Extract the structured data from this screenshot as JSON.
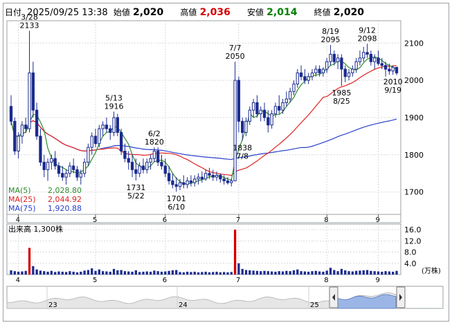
{
  "header": {
    "date_label": "日付",
    "datetime": "2025/09/25 13:38",
    "open_label": "始値",
    "open": "2,020",
    "high_label": "高値",
    "high": "2,036",
    "low_label": "安値",
    "low": "2,014",
    "close_label": "終値",
    "close": "2,020"
  },
  "colors": {
    "ma5": "#2e8b2e",
    "ma25": "#e02020",
    "ma75": "#2a3fc9",
    "candle_up": "#ffffff",
    "candle_down": "#1b2b8f",
    "high_value": "#d40000",
    "low_value": "#008000",
    "volume_bar": "#1b2b8f",
    "volume_spike": "#d40000",
    "nav_area": "#9bb6e6"
  },
  "chart_data": [
    {
      "type": "candlestick",
      "ylim": [
        1640,
        2160
      ],
      "yticks": [
        "2100",
        "2000",
        "1900",
        "1800",
        "1700"
      ],
      "months": [
        "4",
        "5",
        "6",
        "7",
        "8",
        "9"
      ],
      "legend": [
        {
          "name": "MA(5)",
          "value": "2,028.80"
        },
        {
          "name": "MA(25)",
          "value": "2,044.92"
        },
        {
          "name": "MA(75)",
          "value": "1,920.88"
        }
      ],
      "annotations": [
        {
          "date": "3/28",
          "value": "2133"
        },
        {
          "date": "5/13",
          "value": "1916"
        },
        {
          "date": "6/2",
          "value": "1820"
        },
        {
          "date": "5/22",
          "value": "1731"
        },
        {
          "date": "6/10",
          "value": "1701"
        },
        {
          "date": "7/7",
          "value": "2050"
        },
        {
          "date": "7/8",
          "value": "1838"
        },
        {
          "date": "8/19",
          "value": "2095"
        },
        {
          "date": "8/25",
          "value": "1985"
        },
        {
          "date": "9/12",
          "value": "2098"
        },
        {
          "date": "9/19",
          "value": "2010"
        }
      ],
      "ohlc": [
        [
          1930,
          1960,
          1880,
          1890
        ],
        [
          1890,
          1900,
          1800,
          1810
        ],
        [
          1810,
          1860,
          1790,
          1850
        ],
        [
          1850,
          1890,
          1830,
          1880
        ],
        [
          1880,
          1900,
          1860,
          1870
        ],
        [
          1870,
          2133,
          1860,
          2020
        ],
        [
          2020,
          2050,
          1900,
          1920
        ],
        [
          1920,
          1940,
          1840,
          1850
        ],
        [
          1850,
          1870,
          1770,
          1780
        ],
        [
          1780,
          1800,
          1740,
          1760
        ],
        [
          1760,
          1790,
          1730,
          1780
        ],
        [
          1780,
          1800,
          1760,
          1790
        ],
        [
          1790,
          1810,
          1760,
          1770
        ],
        [
          1770,
          1780,
          1740,
          1750
        ],
        [
          1750,
          1770,
          1730,
          1740
        ],
        [
          1740,
          1760,
          1720,
          1750
        ],
        [
          1750,
          1780,
          1740,
          1770
        ],
        [
          1770,
          1790,
          1750,
          1760
        ],
        [
          1760,
          1770,
          1730,
          1740
        ],
        [
          1740,
          1760,
          1720,
          1750
        ],
        [
          1750,
          1790,
          1740,
          1780
        ],
        [
          1780,
          1830,
          1770,
          1820
        ],
        [
          1820,
          1860,
          1800,
          1850
        ],
        [
          1850,
          1870,
          1820,
          1830
        ],
        [
          1830,
          1880,
          1820,
          1870
        ],
        [
          1870,
          1890,
          1850,
          1880
        ],
        [
          1880,
          1900,
          1860,
          1870
        ],
        [
          1870,
          1880,
          1840,
          1860
        ],
        [
          1860,
          1916,
          1850,
          1900
        ],
        [
          1900,
          1910,
          1850,
          1860
        ],
        [
          1860,
          1870,
          1800,
          1810
        ],
        [
          1810,
          1830,
          1780,
          1790
        ],
        [
          1790,
          1810,
          1760,
          1780
        ],
        [
          1780,
          1800,
          1740,
          1760
        ],
        [
          1760,
          1790,
          1731,
          1750
        ],
        [
          1750,
          1780,
          1740,
          1770
        ],
        [
          1770,
          1790,
          1750,
          1760
        ],
        [
          1760,
          1790,
          1750,
          1780
        ],
        [
          1780,
          1800,
          1760,
          1790
        ],
        [
          1790,
          1820,
          1780,
          1810
        ],
        [
          1810,
          1820,
          1770,
          1780
        ],
        [
          1780,
          1800,
          1760,
          1770
        ],
        [
          1770,
          1790,
          1740,
          1750
        ],
        [
          1750,
          1770,
          1720,
          1730
        ],
        [
          1730,
          1750,
          1710,
          1720
        ],
        [
          1720,
          1740,
          1701,
          1715
        ],
        [
          1715,
          1735,
          1705,
          1725
        ],
        [
          1725,
          1745,
          1710,
          1720
        ],
        [
          1720,
          1740,
          1710,
          1730
        ],
        [
          1730,
          1745,
          1715,
          1725
        ],
        [
          1725,
          1745,
          1715,
          1735
        ],
        [
          1735,
          1750,
          1720,
          1740
        ],
        [
          1740,
          1755,
          1725,
          1735
        ],
        [
          1735,
          1760,
          1730,
          1750
        ],
        [
          1750,
          1765,
          1735,
          1745
        ],
        [
          1745,
          1760,
          1730,
          1740
        ],
        [
          1740,
          1755,
          1730,
          1745
        ],
        [
          1745,
          1750,
          1725,
          1735
        ],
        [
          1735,
          1745,
          1720,
          1730
        ],
        [
          1730,
          1740,
          1720,
          1725
        ],
        [
          1725,
          1735,
          1715,
          1730
        ],
        [
          1730,
          2050,
          1838,
          2000
        ],
        [
          2000,
          2010,
          1860,
          1890
        ],
        [
          1890,
          1900,
          1838,
          1860
        ],
        [
          1860,
          1900,
          1850,
          1890
        ],
        [
          1890,
          1930,
          1880,
          1920
        ],
        [
          1920,
          1950,
          1900,
          1940
        ],
        [
          1940,
          1960,
          1900,
          1910
        ],
        [
          1910,
          1930,
          1890,
          1920
        ],
        [
          1920,
          1940,
          1890,
          1900
        ],
        [
          1900,
          1920,
          1860,
          1880
        ],
        [
          1880,
          1920,
          1870,
          1910
        ],
        [
          1910,
          1940,
          1900,
          1930
        ],
        [
          1930,
          1960,
          1910,
          1920
        ],
        [
          1920,
          1950,
          1910,
          1940
        ],
        [
          1940,
          1970,
          1930,
          1950
        ],
        [
          1950,
          1980,
          1940,
          1970
        ],
        [
          1970,
          2000,
          1960,
          1990
        ],
        [
          1990,
          2030,
          1980,
          2020
        ],
        [
          2020,
          2040,
          2000,
          2010
        ],
        [
          2010,
          2030,
          1990,
          2000
        ],
        [
          2000,
          2020,
          1990,
          2010
        ],
        [
          2010,
          2030,
          2000,
          2020
        ],
        [
          2020,
          2040,
          2010,
          2030
        ],
        [
          2030,
          2040,
          2010,
          2020
        ],
        [
          2020,
          2035,
          2010,
          2030
        ],
        [
          2030,
          2060,
          2020,
          2050
        ],
        [
          2050,
          2095,
          2040,
          2070
        ],
        [
          2070,
          2080,
          2040,
          2050
        ],
        [
          2050,
          2070,
          2030,
          2060
        ],
        [
          2060,
          2070,
          1985,
          2030
        ],
        [
          2030,
          2040,
          1995,
          2010
        ],
        [
          2010,
          2030,
          2000,
          2020
        ],
        [
          2020,
          2040,
          2010,
          2030
        ],
        [
          2030,
          2060,
          2020,
          2050
        ],
        [
          2050,
          2080,
          2040,
          2060
        ],
        [
          2060,
          2090,
          2050,
          2075
        ],
        [
          2075,
          2098,
          2060,
          2070
        ],
        [
          2070,
          2080,
          2040,
          2050
        ],
        [
          2050,
          2070,
          2030,
          2060
        ],
        [
          2060,
          2080,
          2040,
          2045
        ],
        [
          2045,
          2060,
          2030,
          2040
        ],
        [
          2040,
          2050,
          2010,
          2030
        ],
        [
          2030,
          2045,
          2015,
          2025
        ],
        [
          2025,
          2040,
          2015,
          2035
        ],
        [
          2035,
          2036,
          2014,
          2020
        ]
      ]
    },
    {
      "type": "bar",
      "title": "出来高",
      "value": "1,300株",
      "unit": "(万株)",
      "ylim": [
        0,
        18
      ],
      "yticks": [
        "16.0",
        "12.0",
        "8.0",
        "4.0"
      ],
      "months": [
        "4",
        "5",
        "6",
        "7",
        "8",
        "9"
      ],
      "values": [
        1.5,
        1.2,
        1.0,
        1.1,
        1.3,
        9.5,
        3.0,
        1.8,
        1.4,
        1.2,
        1.0,
        1.3,
        0.9,
        1.1,
        1.0,
        0.9,
        1.2,
        1.0,
        0.8,
        1.0,
        1.4,
        1.6,
        2.2,
        1.3,
        1.8,
        1.2,
        1.1,
        1.0,
        2.0,
        1.5,
        1.6,
        1.2,
        1.1,
        1.0,
        1.5,
        0.9,
        1.0,
        1.1,
        1.0,
        1.4,
        1.2,
        1.0,
        1.1,
        1.3,
        1.5,
        1.6,
        0.9,
        0.8,
        1.0,
        0.9,
        1.0,
        0.8,
        0.9,
        1.0,
        0.8,
        0.9,
        1.0,
        0.8,
        0.9,
        0.8,
        0.9,
        16.0,
        4.0,
        2.0,
        1.6,
        1.5,
        1.4,
        1.3,
        1.2,
        1.3,
        1.2,
        1.1,
        1.0,
        1.2,
        1.1,
        1.3,
        1.2,
        1.5,
        1.8,
        1.2,
        1.1,
        1.0,
        1.2,
        1.3,
        1.1,
        1.0,
        1.4,
        2.4,
        1.6,
        1.2,
        2.0,
        1.5,
        1.2,
        1.1,
        1.3,
        1.4,
        1.5,
        1.6,
        1.3,
        1.2,
        1.1,
        1.0,
        1.2,
        1.1,
        1.0,
        1.3
      ]
    }
  ],
  "navigator": {
    "labels": [
      "23",
      "24",
      "25"
    ]
  }
}
